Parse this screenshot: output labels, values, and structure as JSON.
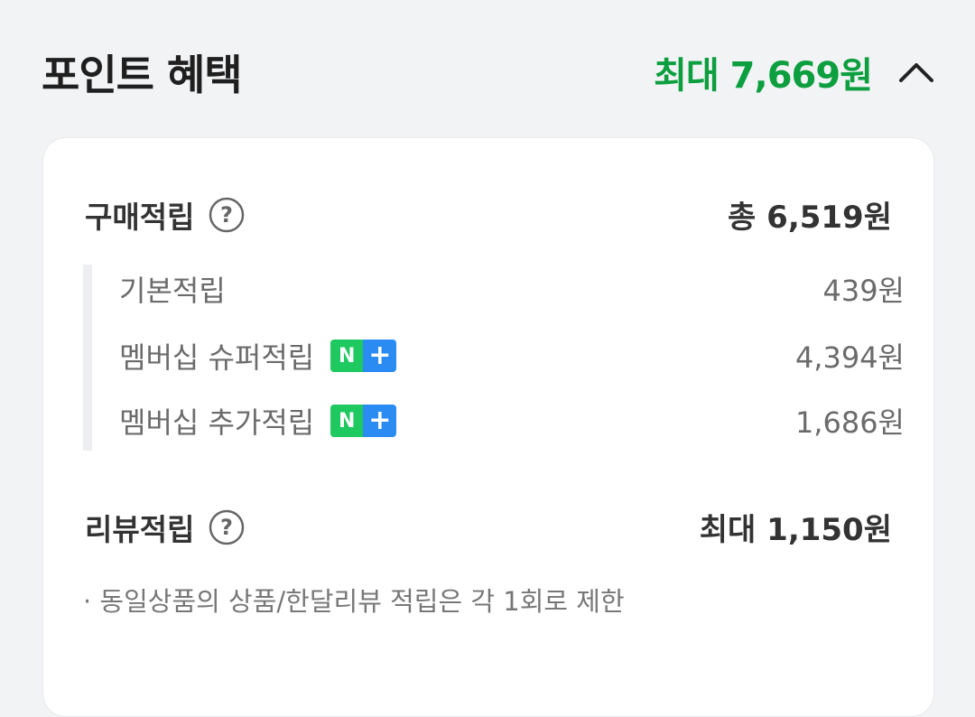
{
  "header": {
    "title": "포인트 혜택",
    "max_benefit": "최대 7,669원",
    "collapse_icon": "chevron-up-icon"
  },
  "purchase": {
    "title": "구매적립",
    "help_icon": "question-circle-icon",
    "total": "총 6,519원",
    "items": [
      {
        "label": "기본적립",
        "amount": "439원",
        "badge": ""
      },
      {
        "label": "멤버십 슈퍼적립",
        "amount": "4,394원",
        "badge_n": "N",
        "badge_plus": "+"
      },
      {
        "label": "멤버십 추가적립",
        "amount": "1,686원",
        "badge_n": "N",
        "badge_plus": "+"
      }
    ]
  },
  "review": {
    "title": "리뷰적립",
    "help_icon": "question-circle-icon",
    "total": "최대 1,150원",
    "note": "· 동일상품의 상품/한달리뷰 적립은 각 1회로 제한"
  },
  "colors": {
    "accent_green": "#0d9f3f",
    "badge_green": "#1ec95f",
    "badge_blue": "#2a8bf2"
  }
}
